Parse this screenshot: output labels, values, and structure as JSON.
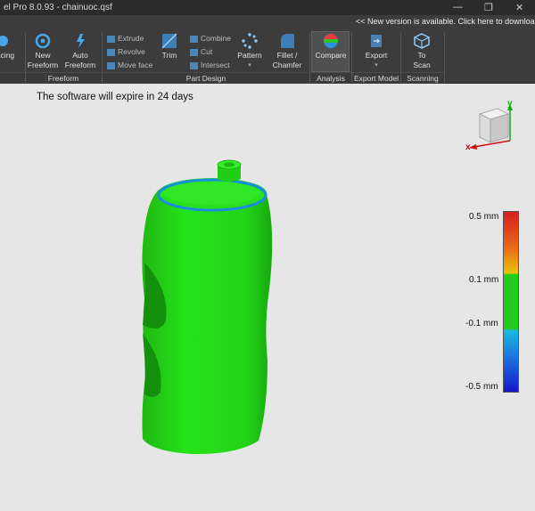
{
  "titlebar": {
    "title": "el Pro 8.0.93 - chainuoc.qsf"
  },
  "update_notice": "<< New version is available. Click here to download >>",
  "ribbon": {
    "partial_tool": "acing",
    "freeform": {
      "new": "New\nFreeform",
      "auto": "Auto\nFreeform",
      "label": "Freeform"
    },
    "part_design": {
      "extrude": "Extrude",
      "revolve": "Revolve",
      "move_face": "Move face",
      "trim": "Trim",
      "combine": "Combine",
      "cut": "Cut",
      "intersect": "Intersect",
      "pattern": "Pattern",
      "fillet": "Fillet /\nChamfer",
      "label": "Part Design"
    },
    "analysis": {
      "compare": "Compare",
      "label": "Analysis"
    },
    "export_model": {
      "export": "Export",
      "label": "Export Model"
    },
    "scanning": {
      "to_scan": "To\nScan",
      "label": "Scanning"
    }
  },
  "viewport": {
    "expire_message": "The software will expire in 24 days",
    "axes": {
      "x": "x",
      "y": "y"
    },
    "legend": [
      "0.5 mm",
      "0.1 mm",
      "-0.1 mm",
      "-0.5 mm"
    ]
  },
  "colors": {
    "model": "#22dd16",
    "rim": "#1a8de0",
    "accent_x": "#cc1111",
    "accent_y": "#11aa11"
  },
  "icons": [
    "window-minimize-icon",
    "window-restore-icon",
    "window-close-icon",
    "new-freeform-icon",
    "auto-freeform-icon",
    "extrude-icon",
    "revolve-icon",
    "move-face-icon",
    "trim-icon",
    "combine-icon",
    "cut-icon",
    "intersect-icon",
    "pattern-icon",
    "fillet-icon",
    "compare-icon",
    "export-icon",
    "scan-icon",
    "view-cube-icon"
  ]
}
